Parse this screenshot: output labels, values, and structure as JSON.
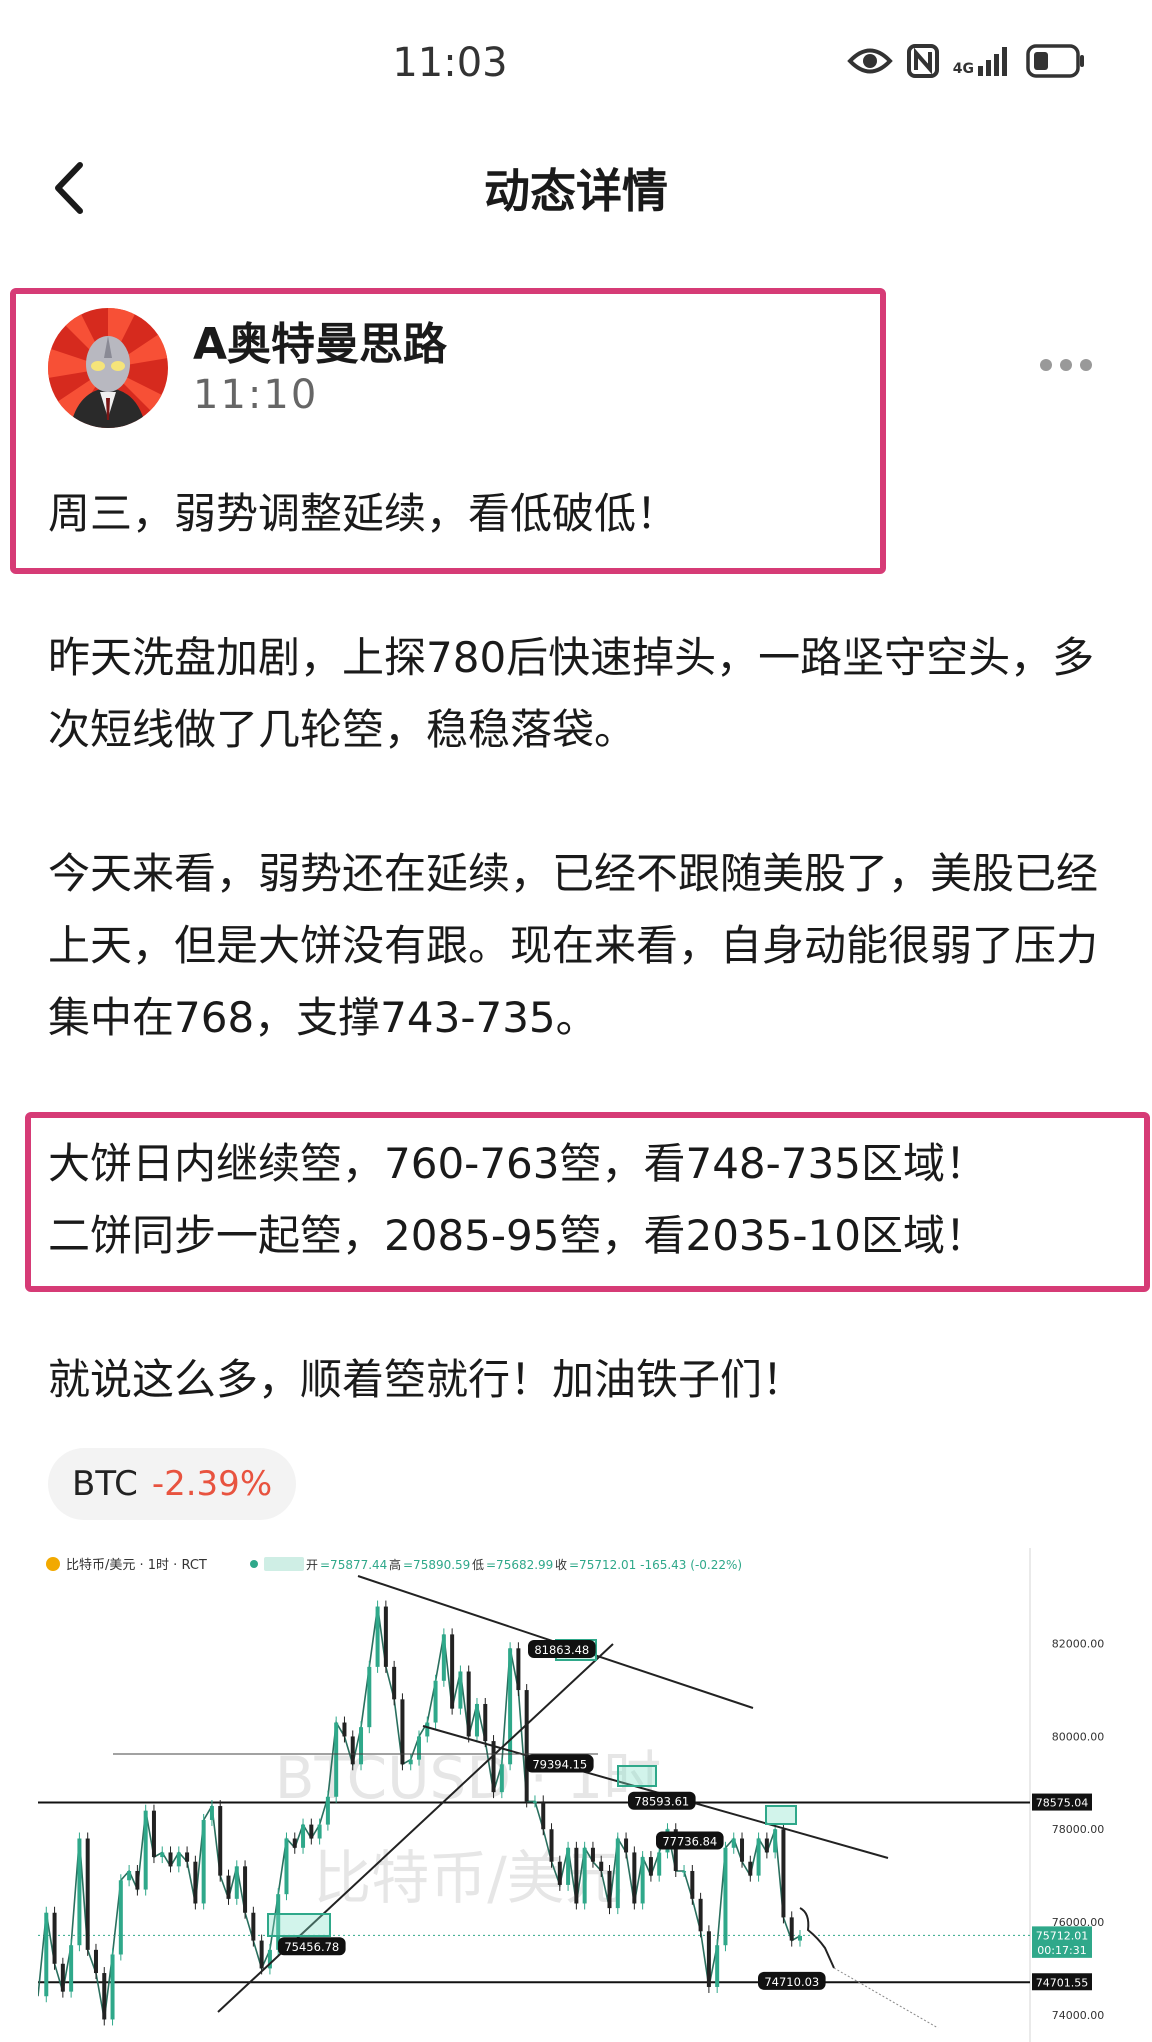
{
  "status_bar": {
    "time": "11:03",
    "network": "4G",
    "icons": [
      "eye-icon",
      "nfc-icon",
      "signal-icon",
      "battery-icon"
    ]
  },
  "nav": {
    "title": "动态详情",
    "back_icon": "chevron-left-icon"
  },
  "post": {
    "author": "A奥特曼思路",
    "time": "11:10",
    "headline": "周三，弱势调整延续，看低破低！",
    "paragraph1": "昨天洗盘加剧，上探780后快速掉头，一路坚守空头，多次短线做了几轮箜，稳稳落袋。",
    "paragraph2": "今天来看，弱势还在延续，已经不跟随美股了，美股已经上天，但是大饼没有跟。现在来看，自身动能很弱了压力集中在768，支撑743-735。",
    "strategy_line1": "大饼日内继续箜，760-763箜，看748-735区域！",
    "strategy_line2": "二饼同步一起箜，2085-95箜，看2035-10区域！",
    "closing": "就说这么多，顺着箜就行！加油铁子们！"
  },
  "tag": {
    "symbol": "BTC",
    "change": "-2.39%"
  },
  "colors": {
    "accent_box": "#d63b76",
    "negative": "#e8533f",
    "candle_up": "#2fa88a",
    "candle_down": "#222222",
    "highlight": "#7fe0c7"
  },
  "chart_data": {
    "type": "line",
    "header": "比特币/美元 · 1时 · RCT",
    "ohlc_label": {
      "open_label": "开",
      "open": "=75877.44",
      "high_label": "高",
      "high": "=75890.59",
      "low_label": "低",
      "low": "=75682.99",
      "close_label": "收",
      "close": "=75712.01 -165.43 (-0.22%)"
    },
    "watermark_line1": "BTCUSD · 1时",
    "watermark_line2": "比特币/美元",
    "y_ticks": [
      "82000.00",
      "80000.00",
      "78000.00",
      "76000.00",
      "74000.00"
    ],
    "y_tick_values": [
      82000,
      80000,
      78000,
      76000,
      74000
    ],
    "ylim": [
      73500,
      83200
    ],
    "series": [
      {
        "values": [
          74400,
          76200,
          75100,
          74500,
          75500,
          77800,
          75400,
          74900,
          73900,
          75300,
          76900,
          77100,
          76700,
          78400,
          77400,
          77500,
          77200,
          77500,
          77300,
          76400,
          78200,
          78500,
          77000,
          76500,
          77200,
          76200,
          75600,
          75000,
          75400,
          76600,
          77800,
          77600,
          78100,
          77800,
          78100,
          78700,
          80300,
          80000,
          79400,
          80200,
          81500,
          82800,
          81500,
          80800,
          79400,
          79500,
          80000,
          80300,
          81200,
          82200,
          80600,
          81400,
          80000,
          80700,
          79900,
          78800,
          79400,
          81900,
          81000,
          78600,
          78600,
          78000,
          77300,
          76800,
          77600,
          76400,
          77600,
          77300,
          77100,
          76300,
          77800,
          77500,
          76400,
          77400,
          77000,
          77500,
          78000,
          77100,
          77100,
          76500,
          75800,
          74600,
          75500,
          77600,
          77800,
          77300,
          77000,
          77800,
          77500,
          78000,
          76100,
          75600,
          75700
        ]
      }
    ],
    "price_labels": [
      "81863.48",
      "79394.15",
      "78593.61",
      "77736.84",
      "75456.78",
      "74710.03"
    ],
    "price_label_values": [
      81863.48,
      79394.15,
      78593.61,
      77736.84,
      75456.78,
      74710.03
    ],
    "right_marks": [
      {
        "label": "78575.04",
        "value": 78575.04
      },
      {
        "label": "75712.01",
        "value": 75712.01
      },
      {
        "label": "00:17:31",
        "value": 75400
      },
      {
        "label": "74701.55",
        "value": 74701.55
      }
    ]
  }
}
